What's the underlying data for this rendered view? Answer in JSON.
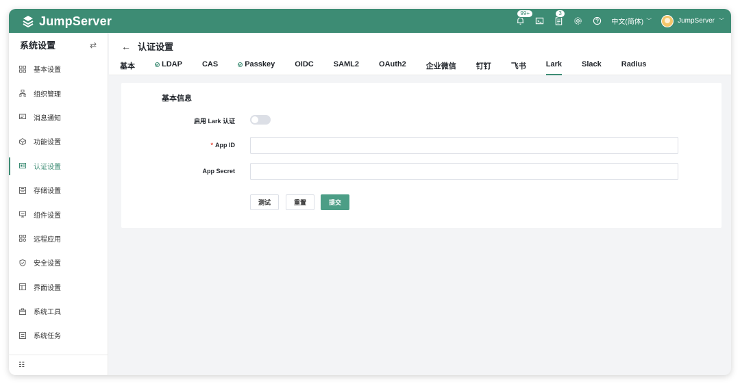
{
  "app": {
    "name": "JumpServer"
  },
  "topbar": {
    "notifications_badge": "99+",
    "tasks_badge": "3",
    "language": "中文(简体)",
    "user": "JumpServer",
    "icons": [
      "bell-icon",
      "terminal-icon",
      "clipboard-icon",
      "gear-icon",
      "help-icon"
    ]
  },
  "sidebar": {
    "title": "系统设置",
    "items": [
      {
        "label": "基本设置",
        "icon": "grid-icon"
      },
      {
        "label": "组织管理",
        "icon": "org-icon"
      },
      {
        "label": "消息通知",
        "icon": "message-icon"
      },
      {
        "label": "功能设置",
        "icon": "cube-icon"
      },
      {
        "label": "认证设置",
        "icon": "id-card-icon",
        "active": true
      },
      {
        "label": "存储设置",
        "icon": "storage-icon"
      },
      {
        "label": "组件设置",
        "icon": "component-icon"
      },
      {
        "label": "远程应用",
        "icon": "apps-icon"
      },
      {
        "label": "安全设置",
        "icon": "shield-icon"
      },
      {
        "label": "界面设置",
        "icon": "layout-icon"
      },
      {
        "label": "系统工具",
        "icon": "toolbox-icon"
      },
      {
        "label": "系统任务",
        "icon": "tasks-icon"
      }
    ]
  },
  "page": {
    "title": "认证设置",
    "tabs": [
      {
        "label": "基本",
        "ok": false
      },
      {
        "label": "LDAP",
        "ok": true
      },
      {
        "label": "CAS",
        "ok": false
      },
      {
        "label": "Passkey",
        "ok": true
      },
      {
        "label": "OIDC",
        "ok": false
      },
      {
        "label": "SAML2",
        "ok": false
      },
      {
        "label": "OAuth2",
        "ok": false
      },
      {
        "label": "企业微信",
        "ok": false
      },
      {
        "label": "钉钉",
        "ok": false
      },
      {
        "label": "飞书",
        "ok": false
      },
      {
        "label": "Lark",
        "ok": false,
        "active": true
      },
      {
        "label": "Slack",
        "ok": false
      },
      {
        "label": "Radius",
        "ok": false
      }
    ]
  },
  "form": {
    "section_title": "基本信息",
    "enable_label": "启用 Lark 认证",
    "enable_value": false,
    "app_id_label": "App ID",
    "app_id_required": "*",
    "app_id_value": "",
    "app_secret_label": "App Secret",
    "app_secret_value": "",
    "buttons": {
      "test": "测试",
      "reset": "重置",
      "submit": "提交"
    }
  },
  "colors": {
    "brand": "#3d8c74",
    "primary_button": "#4c9e86",
    "required": "#e74c3c"
  }
}
